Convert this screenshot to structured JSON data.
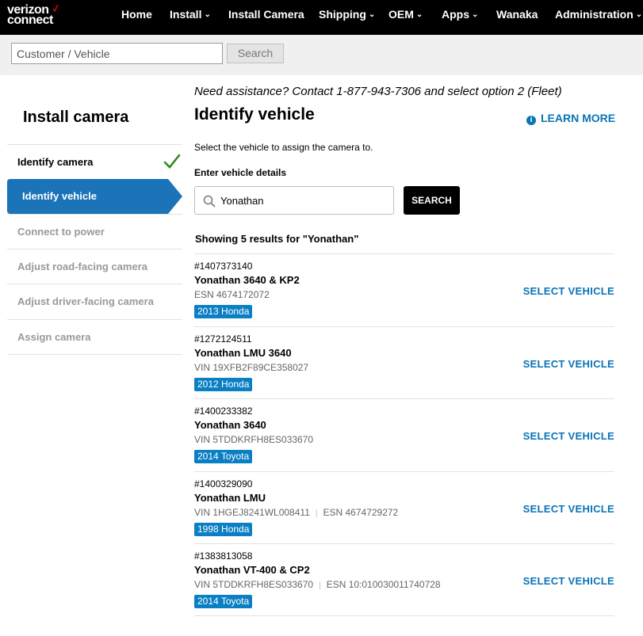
{
  "brand": {
    "line1": "verizon",
    "line2": "connect",
    "accent": "#cd040b"
  },
  "nav": {
    "items": [
      {
        "label": "Home",
        "dropdown": false
      },
      {
        "label": "Install",
        "dropdown": true
      },
      {
        "label": "Install Camera",
        "dropdown": false
      },
      {
        "label": "Shipping",
        "dropdown": true
      },
      {
        "label": "OEM",
        "dropdown": true
      },
      {
        "label": "Apps",
        "dropdown": true
      },
      {
        "label": "Wanaka",
        "dropdown": false
      },
      {
        "label": "Administration",
        "dropdown": true
      }
    ]
  },
  "global_search": {
    "placeholder": "Customer / Vehicle",
    "value": "",
    "button": "Search"
  },
  "sidebar": {
    "title": "Install camera",
    "steps": [
      {
        "label": "Identify camera",
        "state": "done"
      },
      {
        "label": "Identify vehicle",
        "state": "active"
      },
      {
        "label": "Connect to power",
        "state": "future"
      },
      {
        "label": "Adjust road-facing camera",
        "state": "future"
      },
      {
        "label": "Adjust driver-facing camera",
        "state": "future"
      },
      {
        "label": "Assign camera",
        "state": "future"
      }
    ],
    "active_color": "#1b73b8",
    "done_color": "#2e8b1e"
  },
  "main": {
    "assist": "Need assistance? Contact 1-877-943-7306 and select option 2 (Fleet)",
    "title": "Identify vehicle",
    "learn_more": "LEARN MORE",
    "subtext": "Select the vehicle to assign the camera to.",
    "field_label": "Enter vehicle details",
    "search_value": "Yonathan",
    "search_button": "SEARCH",
    "results_count": "Showing 5 results for \"Yonathan\"",
    "select_label": "SELECT VEHICLE",
    "results": [
      {
        "num": "#1407373140",
        "name": "Yonathan 3640 & KP2",
        "ids": [
          "ESN 4674172072"
        ],
        "badge": "2013 Honda"
      },
      {
        "num": "#1272124511",
        "name": "Yonathan LMU 3640",
        "ids": [
          "VIN 19XFB2F89CE358027"
        ],
        "badge": "2012 Honda"
      },
      {
        "num": "#1400233382",
        "name": "Yonathan 3640",
        "ids": [
          "VIN 5TDDKRFH8ES033670"
        ],
        "badge": "2014 Toyota"
      },
      {
        "num": "#1400329090",
        "name": "Yonathan LMU",
        "ids": [
          "VIN 1HGEJ8241WL008411",
          "ESN 4674729272"
        ],
        "badge": "1998 Honda"
      },
      {
        "num": "#1383813058",
        "name": "Yonathan VT-400 & CP2",
        "ids": [
          "VIN 5TDDKRFH8ES033670",
          "ESN 10:010030011740728"
        ],
        "badge": "2014 Toyota"
      }
    ]
  }
}
